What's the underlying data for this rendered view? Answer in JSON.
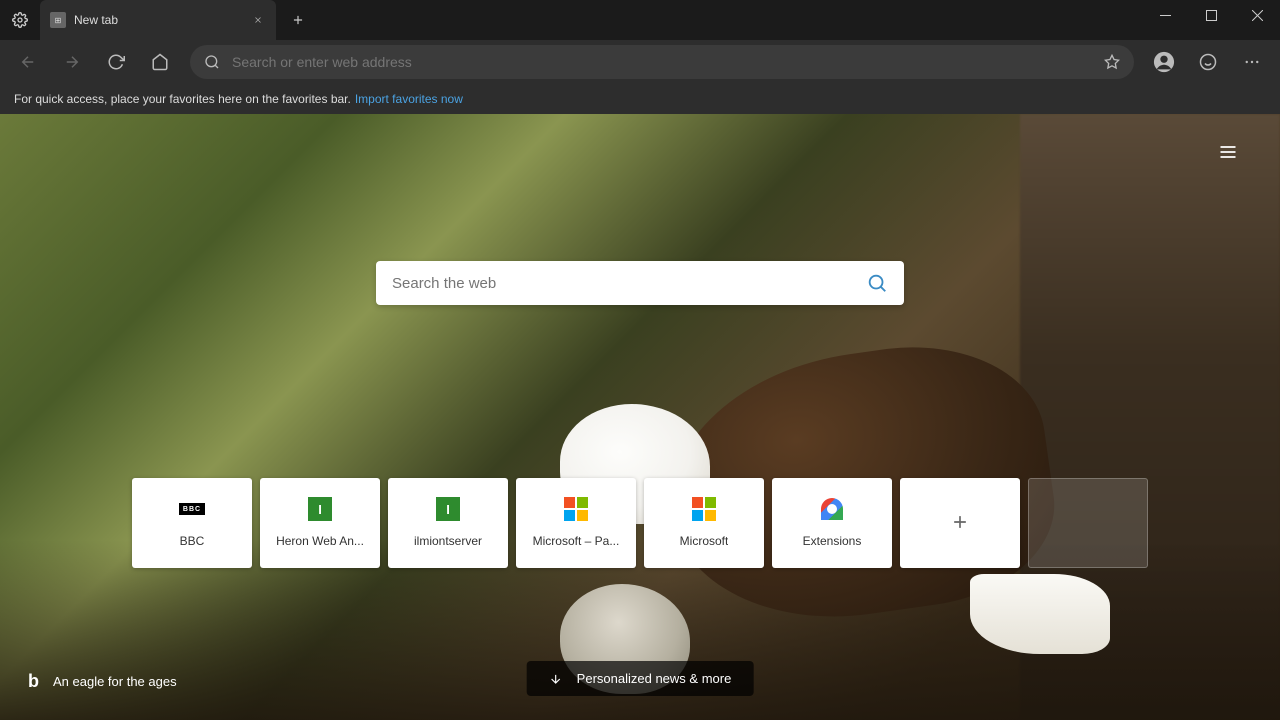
{
  "tab": {
    "title": "New tab"
  },
  "addressbar": {
    "placeholder": "Search or enter web address"
  },
  "favbar": {
    "message": "For quick access, place your favorites here on the favorites bar.",
    "link": "Import favorites now"
  },
  "center_search": {
    "placeholder": "Search the web"
  },
  "tiles": [
    {
      "label": "BBC",
      "icon": "bbc"
    },
    {
      "label": "Heron Web An...",
      "icon": "green-i"
    },
    {
      "label": "ilmiontserver",
      "icon": "green-i"
    },
    {
      "label": "Microsoft – Pa...",
      "icon": "ms"
    },
    {
      "label": "Microsoft",
      "icon": "ms"
    },
    {
      "label": "Extensions",
      "icon": "ext"
    }
  ],
  "bg_caption": "An eagle for the ages",
  "news_button": "Personalized news & more"
}
